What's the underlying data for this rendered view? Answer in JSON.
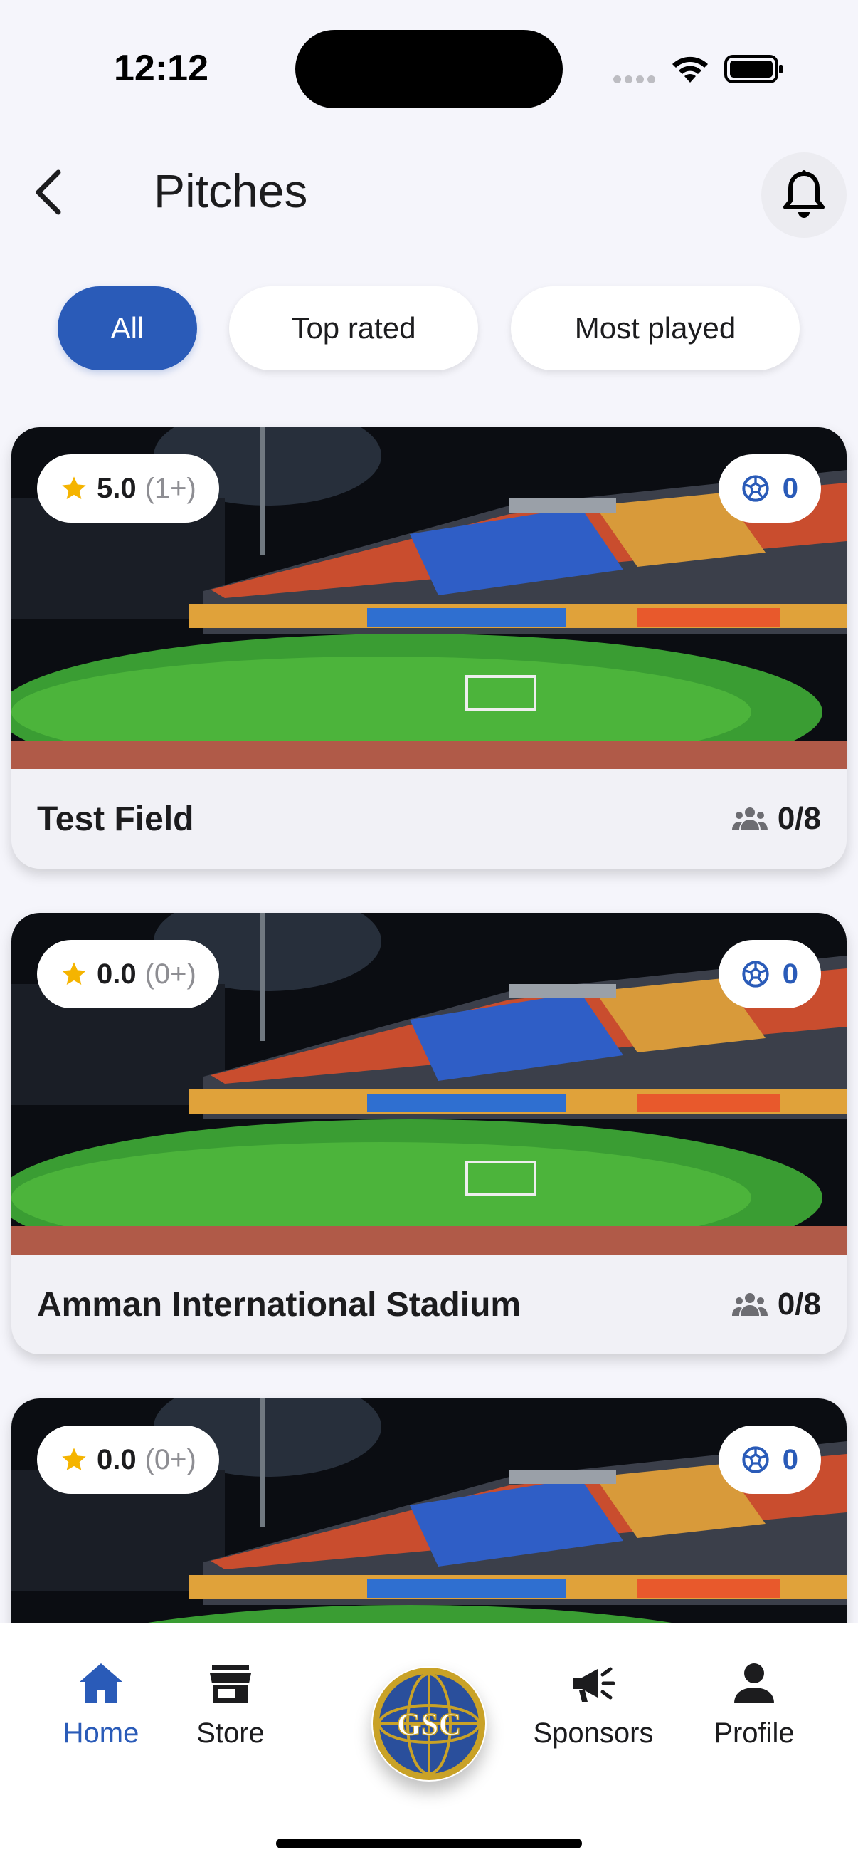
{
  "status_bar": {
    "time": "12:12",
    "icons": [
      "signal-dots-icon",
      "wifi-icon",
      "battery-icon"
    ]
  },
  "header": {
    "title": "Pitches",
    "back_icon": "chevron-left-icon",
    "notification_icon": "bell-icon"
  },
  "filters": {
    "selected": "All",
    "items": [
      "All",
      "Top rated",
      "Most played"
    ]
  },
  "pitches": [
    {
      "name": "Test Field",
      "rating": "5.0",
      "rating_count": "(1+)",
      "matches": "0",
      "players": "0/8"
    },
    {
      "name": "Amman International Stadium",
      "rating": "0.0",
      "rating_count": "(0+)",
      "matches": "0",
      "players": "0/8"
    },
    {
      "name": "",
      "rating": "0.0",
      "rating_count": "(0+)",
      "matches": "0",
      "players": ""
    }
  ],
  "bottom_nav": {
    "items": [
      {
        "label": "Home",
        "icon": "home-icon",
        "active": true
      },
      {
        "label": "Store",
        "icon": "store-icon",
        "active": false
      },
      {
        "label": "Sponsors",
        "icon": "megaphone-icon",
        "active": false
      },
      {
        "label": "Profile",
        "icon": "person-icon",
        "active": false
      }
    ],
    "center_logo": {
      "text": "GSC",
      "icon": "gsc-logo"
    }
  },
  "colors": {
    "primary": "#2a5bb8",
    "star": "#f5b400",
    "background": "#f5f5fb",
    "text": "#1c1c1e"
  }
}
